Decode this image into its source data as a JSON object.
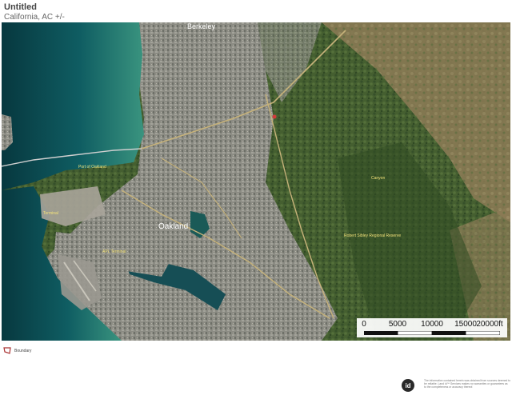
{
  "header": {
    "title": "Untitled",
    "subtitle": "California,  AC +/-"
  },
  "map": {
    "type": "satellite",
    "place_labels": {
      "berkeley": "Berkeley",
      "oakland": "Oakland",
      "port": "Port of Oakland",
      "terminal": "Terminal",
      "apl": "APL Terminal",
      "canyon": "Canyon",
      "reserve": "Robert Sibley Regional Reserve"
    },
    "colors": {
      "water_deep": "#0b4f5b",
      "water_shallow": "#2f8a7e",
      "urban": "#8a8a82",
      "forest": "#3f5a2c",
      "hills_dry": "#8c7a55",
      "boundary": "#d23a3a"
    }
  },
  "scale": {
    "labels": [
      "0",
      "5000",
      "10000",
      "15000",
      "20000ft"
    ]
  },
  "legend": {
    "label": "Boundary",
    "color": "#a33"
  },
  "footer": {
    "logo": "id",
    "disclaimer": "The information contained herein was obtained from sources deemed to be reliable. Land id™ Services makes no warranties or guarantees as to the completeness or accuracy thereof."
  }
}
